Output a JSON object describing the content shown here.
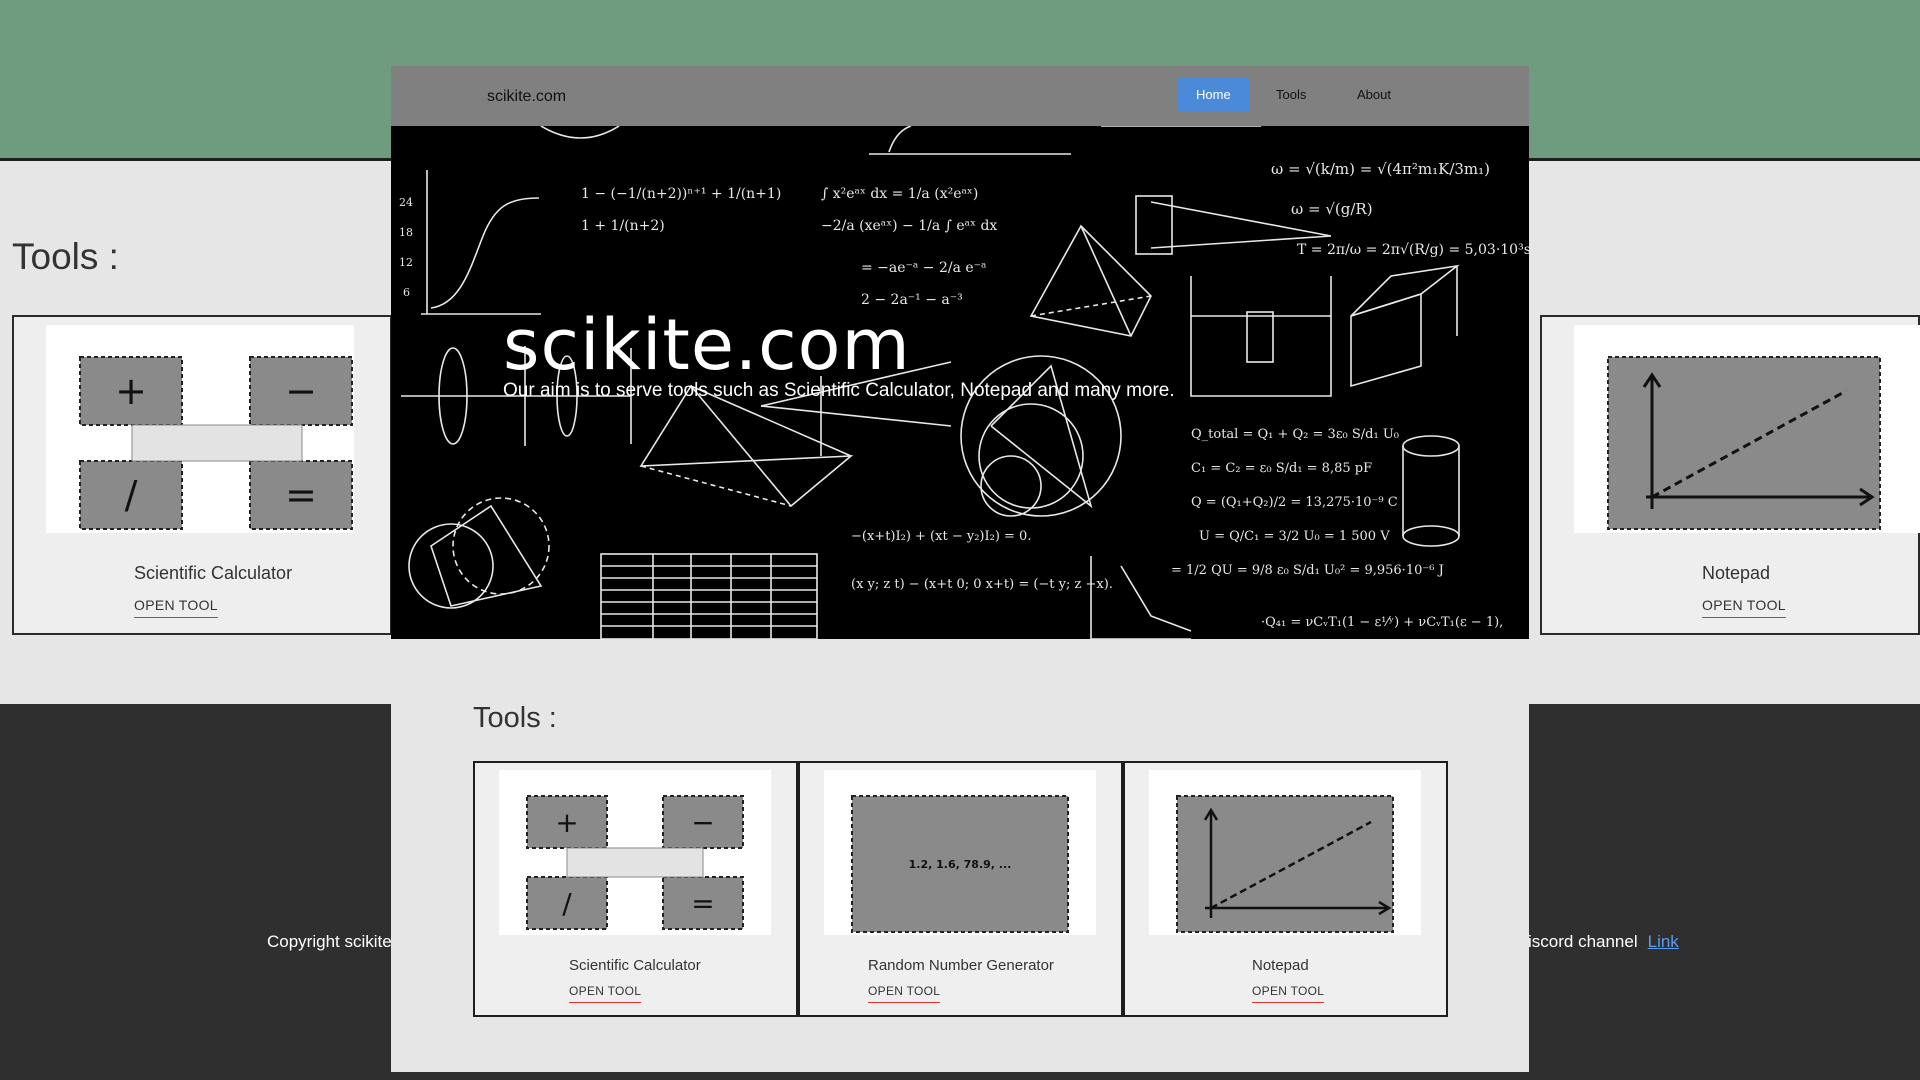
{
  "background_page": {
    "heading": "Tools :",
    "cards": [
      {
        "title": "Scientific Calculator",
        "link": "OPEN TOOL"
      },
      {
        "title": "Notepad",
        "link": "OPEN TOOL"
      }
    ],
    "footer_left": "Copyright scikite",
    "footer_right": "iscord channel",
    "footer_link": "Link"
  },
  "nav": {
    "brand": "scikite.com",
    "items": [
      {
        "label": "Home",
        "active": true
      },
      {
        "label": "Tools",
        "active": false
      },
      {
        "label": "About",
        "active": false
      }
    ]
  },
  "hero": {
    "title": "scikite.com",
    "subtitle": "Our aim is to serve tools such as Scientific Calculator, Notepad and many more."
  },
  "tools": {
    "heading": "Tools :",
    "cards": [
      {
        "title": "Scientific Calculator",
        "link": "OPEN TOOL",
        "icon": "calculator-icon"
      },
      {
        "title": "Random Number Generator",
        "link": "OPEN TOOL",
        "icon": "random-numbers-icon",
        "thumb_text": "1.2, 1.6, 78.9, ..."
      },
      {
        "title": "Notepad",
        "link": "OPEN TOOL",
        "icon": "chart-line-icon"
      }
    ]
  },
  "colors": {
    "nav_bg": "#808080",
    "active_nav": "#4a8ad8",
    "page_bg": "#e6e6e6",
    "header_band": "#6f9b7e",
    "footer_bg": "#2f2f2f",
    "link_underline": "#e03030"
  }
}
